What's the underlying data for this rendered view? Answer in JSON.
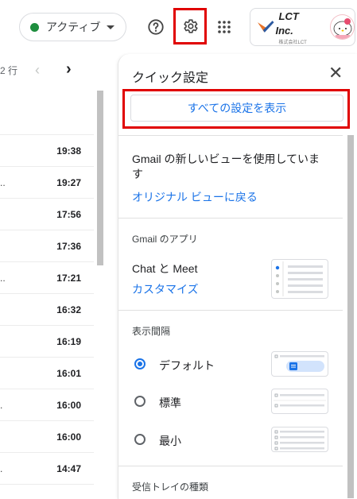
{
  "header": {
    "status_label": "アクティブ",
    "status_color": "#1e8e3e",
    "help_icon": "help-icon",
    "settings_icon": "gear-icon",
    "apps_icon": "apps-grid-icon",
    "settings_tooltip": "設定",
    "account_logo_text": "LCT Inc.",
    "account_logo_subtext": "株式会社LCT",
    "avatar_icon": "character-avatar"
  },
  "pager": {
    "rows_partial": "2 行",
    "prev_icon": "chevron-left-icon",
    "next_icon": "chevron-right-icon"
  },
  "mail_times": [
    {
      "prefix": "",
      "time": "19:38"
    },
    {
      "prefix": "..",
      "time": "19:27"
    },
    {
      "prefix": "",
      "time": "17:56"
    },
    {
      "prefix": "",
      "time": "17:36"
    },
    {
      "prefix": "..",
      "time": "17:21"
    },
    {
      "prefix": "",
      "time": "16:32"
    },
    {
      "prefix": "",
      "time": "16:19"
    },
    {
      "prefix": "",
      "time": "16:01"
    },
    {
      "prefix": ".",
      "time": "16:00"
    },
    {
      "prefix": "",
      "time": "16:00"
    },
    {
      "prefix": ".",
      "time": "14:47"
    }
  ],
  "quick_settings": {
    "title": "クイック設定",
    "close_icon": "close-icon",
    "all_settings_label": "すべての設定を表示",
    "highlight_color": "#e00000",
    "new_view_text_line1": "Gmail の新しいビューを使用していま",
    "new_view_text_line2": "す",
    "back_to_original_link": "オリジナル ビューに戻る",
    "apps_section_title": "Gmail のアプリ",
    "chat_meet_label": "Chat と Meet",
    "customize_link": "カスタマイズ",
    "density_section_title": "表示間隔",
    "density_options": [
      {
        "label": "デフォルト",
        "selected": true
      },
      {
        "label": "標準",
        "selected": false
      },
      {
        "label": "最小",
        "selected": false
      }
    ],
    "inbox_type_section_title": "受信トレイの種類"
  }
}
